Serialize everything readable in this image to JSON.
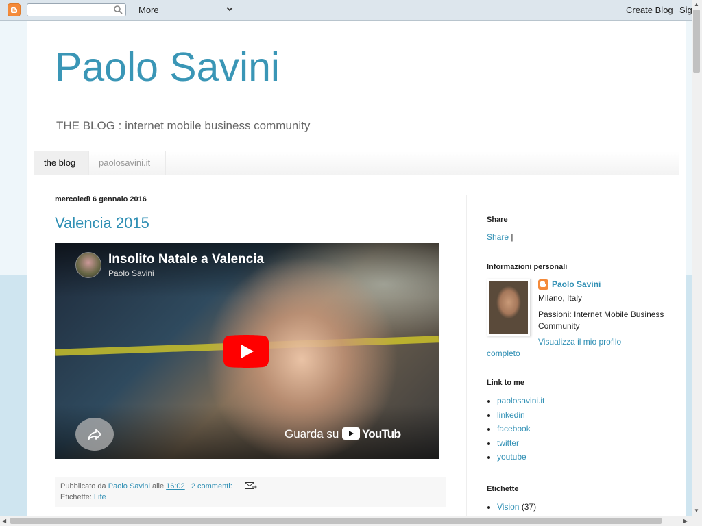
{
  "navbar": {
    "search_value": "",
    "more_label": "More",
    "create_blog_label": "Create Blog",
    "sign_in_label": "Sig"
  },
  "header": {
    "title": "Paolo Savini",
    "description": "THE BLOG : internet mobile business community"
  },
  "tabs": [
    {
      "label": "the blog",
      "active": true
    },
    {
      "label": "paolosavini.it",
      "active": false
    }
  ],
  "post": {
    "date": "mercoledì 6 gennaio 2016",
    "title": "Valencia 2015",
    "video": {
      "title": "Insolito Natale a Valencia",
      "channel": "Paolo Savini",
      "watch_label": "Guarda su",
      "brand": "YouTube"
    },
    "footer": {
      "published_by": "Pubblicato da",
      "author": "Paolo Savini",
      "at": "alle",
      "time": "16:02",
      "comments": "2 commenti:",
      "labels_prefix": "Etichette:",
      "label": "Life"
    }
  },
  "sidebar": {
    "share": {
      "heading": "Share",
      "link": "Share",
      "separator": "|"
    },
    "profile": {
      "heading": "Informazioni personali",
      "name": "Paolo Savini",
      "location": "Milano, Italy",
      "passions": "Passioni: Internet Mobile Business Community",
      "view_profile": "Visualizza il mio profilo completo"
    },
    "links": {
      "heading": "Link to me",
      "items": [
        "paolosavini.it",
        "linkedin",
        "facebook",
        "twitter",
        "youtube"
      ]
    },
    "labels": {
      "heading": "Etichette",
      "items": [
        {
          "name": "Vision",
          "count": "(37)"
        }
      ]
    }
  },
  "colors": {
    "accent": "#2f8fb4",
    "title": "#3a96b6",
    "blogger_orange": "#f48a3a",
    "youtube_red": "#ff0000"
  }
}
